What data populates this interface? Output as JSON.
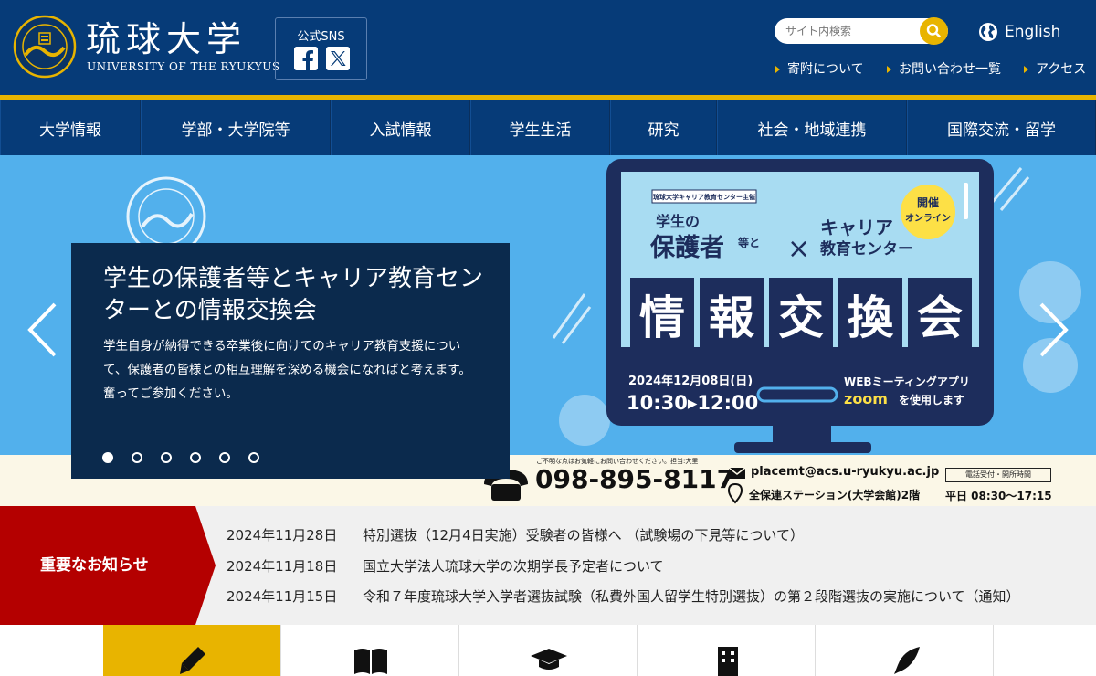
{
  "header": {
    "logo_jp": "琉球大学",
    "logo_en": "UNIVERSITY OF THE RYUKYUS",
    "sns_label": "公式SNS",
    "search_placeholder": "サイト内検索",
    "language": "English",
    "util_links": [
      "寄附について",
      "お問い合わせ一覧",
      "アクセス"
    ]
  },
  "nav": {
    "items": [
      "大学情報",
      "学部・大学院等",
      "入試情報",
      "学生生活",
      "研究",
      "社会・地域連携",
      "国際交流・留学"
    ]
  },
  "hero": {
    "caption_title": "学生の保護者等とキャリア教育センターとの情報交換会",
    "caption_body": "学生自身が納得できる卒業後に向けてのキャリア教育支援について、保護者の皆様との相互理解を深める機会になればと考えます。奮ってご参加ください。",
    "slide_count": 6,
    "active_slide": 1,
    "poster": {
      "host": "琉球大学キャリア教育センター主催",
      "left_heading_1": "学生の",
      "left_heading_2": "保護者",
      "left_heading_3": "等と",
      "right_heading_1": "キャリア",
      "right_heading_2": "教育センター",
      "badge_1": "開催",
      "badge_2": "オンライン",
      "big_title": [
        "情",
        "報",
        "交",
        "換",
        "会"
      ],
      "date": "2024年12月08日(日)",
      "time": "10:30▸12:00",
      "web_app": "WEBミーティングアプリ",
      "zoom": "zoom",
      "zoom_suffix": "を使用します"
    },
    "contact": {
      "note": "ご不明な点はお気軽にお問い合わせください。担当:大里",
      "phone": "098-895-8117",
      "email": "placemt@acs.u-ryukyu.ac.jp",
      "place": "全保連ステーション(大学会館)2階",
      "hours_label": "電話受付・開所時間",
      "hours": "平日 08:30〜17:15"
    }
  },
  "news": {
    "label": "重要なお知らせ",
    "items": [
      {
        "date": "2024年11月28日",
        "title": "特別選抜（12月4日実施）受験者の皆様へ （試験場の下見等について）"
      },
      {
        "date": "2024年11月18日",
        "title": "国立大学法人琉球大学の次期学長予定者について"
      },
      {
        "date": "2024年11月15日",
        "title": "令和７年度琉球大学入学者選抜試験（私費外国人留学生特別選抜）の第２段階選抜の実施について（通知）"
      }
    ]
  },
  "colors": {
    "navy": "#063b78",
    "gold": "#e8b400",
    "alert_red": "#b40000",
    "hero_blue": "#52b0ec"
  },
  "tiles": {
    "icons": [
      "pen-icon",
      "book-icon",
      "graduation-cap-icon",
      "building-icon",
      "quill-icon"
    ]
  }
}
